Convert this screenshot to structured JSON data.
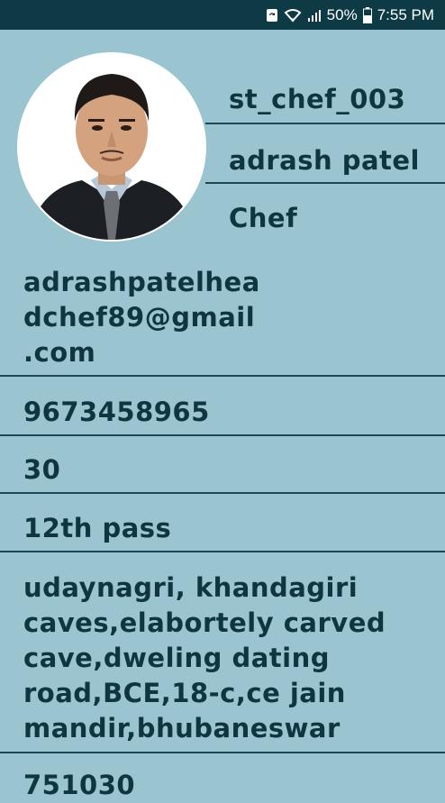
{
  "status_bar": {
    "battery": "50%",
    "time": "7:55 PM",
    "icons": [
      "sync-icon",
      "wifi-icon",
      "signal-icon",
      "battery-icon"
    ]
  },
  "profile": {
    "chef_id": "st_chef_003",
    "name": "adrash patel",
    "role": "Chef",
    "email": "adrashpatelhea\ndchef89@gmail\n.com",
    "phone": "9673458965",
    "age": "30",
    "education": "12th pass",
    "address": "udaynagri, khandagiri\ncaves,elabortely carved\ncave,dweling dating\nroad,BCE,18-c,ce jain\nmandir,bhubaneswar",
    "pincode": "751030"
  },
  "colors": {
    "background": "#9bc4d1",
    "status_bar": "#0e3a45",
    "text": "#0f3540",
    "divider": "#1d4853"
  }
}
